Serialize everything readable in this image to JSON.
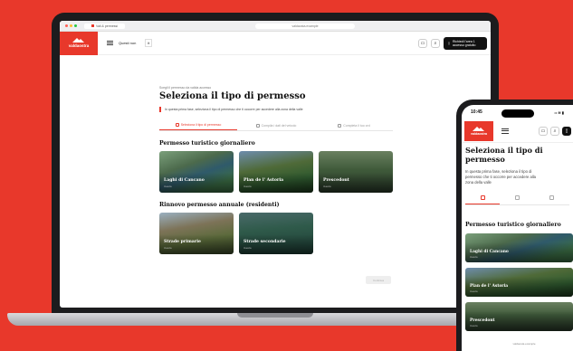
{
  "colors": {
    "brand": "#e8382b",
    "ink": "#111111"
  },
  "browser": {
    "tab_title": "Vali & permessi",
    "url": "valdaosta.example"
  },
  "site": {
    "logo_text": "valdaostra",
    "nav_link": "Questi non",
    "lang": "it",
    "cta": "Richiedi l'area 1 accesso gratuito"
  },
  "page": {
    "hint": "Scegli il permesso da valida accesso",
    "title": "Seleziona il tipo di permesso",
    "intro": "In questa prima fase, seleziona il tipo di permesso che ti occorre per accedere alla zona della valle",
    "steps": [
      {
        "label": "Seleziona il tipo di permesso"
      },
      {
        "label": "Compila i dati del veicolo"
      },
      {
        "label": "Completa il tuo ord"
      }
    ],
    "section1_title": "Permesso turistico giornaliero",
    "section1_cards": [
      {
        "label": "Laghi di Cancano",
        "sub": "4 euro"
      },
      {
        "label": "Plan de l' Astoria",
        "sub": "4 euro"
      },
      {
        "label": "Prescedont",
        "sub": "4 euro"
      }
    ],
    "section2_title": "Rinnovo permesso annuale (residenti)",
    "section2_cards": [
      {
        "label": "Strade primarie",
        "sub": "4 euro"
      },
      {
        "label": "Strade secondarie",
        "sub": "4 euro"
      }
    ],
    "continue_label": "Continua"
  },
  "phone": {
    "time": "10:45",
    "signal": "•• ≋ ▮",
    "logo_text": "valdaostra",
    "title": "Seleziona il tipo di permesso",
    "intro": "In questa prima fase, seleziona il tipo di permesso che ti occorre per accedere alla zona della valle",
    "section_title": "Permesso turistico giornaliero",
    "cards": [
      {
        "label": "Laghi di Cancano",
        "sub": "4 euro"
      },
      {
        "label": "Plan de l' Astoria",
        "sub": "4 euro"
      },
      {
        "label": "Prescedont",
        "sub": "4 euro"
      }
    ],
    "url": "valdaosta.example"
  }
}
